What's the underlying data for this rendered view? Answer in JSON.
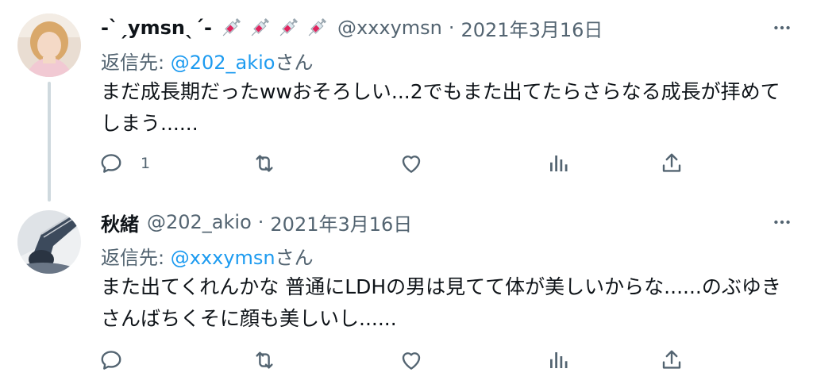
{
  "tweets": [
    {
      "display_name": "-ˋˏymsnˎˊ-",
      "name_emojis": [
        "syringe",
        "syringe",
        "syringe",
        "syringe"
      ],
      "handle": "@xxxymsn",
      "separator": "·",
      "date": "2021年3月16日",
      "reply_prefix": "返信先: ",
      "reply_mention": "@202_akio",
      "reply_suffix": "さん",
      "text": "まだ成長期だったwwおそろしい...2でもまた出てたらさらなる成長が拝めてしまう......",
      "reply_count": "1"
    },
    {
      "display_name": "秋緒",
      "name_emojis": [],
      "handle": "@202_akio",
      "separator": "·",
      "date": "2021年3月16日",
      "reply_prefix": "返信先: ",
      "reply_mention": "@xxxymsn",
      "reply_suffix": "さん",
      "text": "また出てくれんかな 普通にLDHの男は見てて体が美しいからな......のぶゆきさんばちくそに顔も美しいし......",
      "reply_count": ""
    }
  ],
  "colors": {
    "text": "#0f1419",
    "secondary": "#536471",
    "link": "#1d9bf0",
    "thread_line": "#cfd9de"
  }
}
